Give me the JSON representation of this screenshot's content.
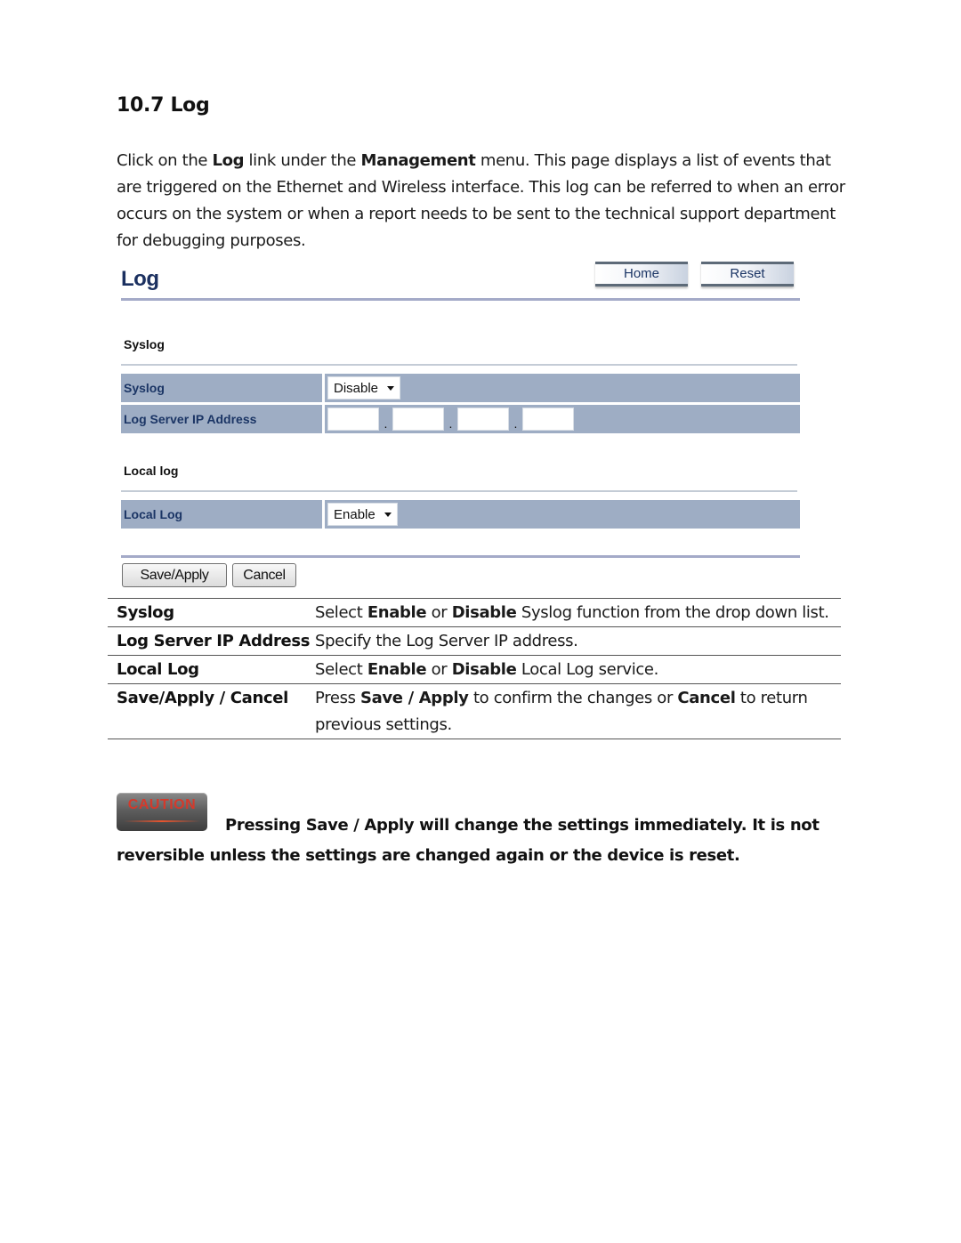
{
  "section_title": "10.7 Log",
  "intro": {
    "p1": "Click on the ",
    "b1": "Log",
    "p2": " link under the ",
    "b2": "Management",
    "p3": " menu. This page displays a list of events that are triggered on the Ethernet and Wireless interface. This log can be referred to when an error occurs on the system or when a report needs to be sent to the technical support department for debugging purposes."
  },
  "ui": {
    "title": "Log",
    "home_label": "Home",
    "reset_label": "Reset",
    "syslog_section": "Syslog",
    "syslog_row_label": "Syslog",
    "syslog_value": "Disable",
    "log_server_label": "Log Server IP Address",
    "ip_octets": [
      "",
      "",
      "",
      ""
    ],
    "ip_separator": ".",
    "local_section": "Local log",
    "local_row_label": "Local Log",
    "local_value": "Enable",
    "save_label": "Save/Apply",
    "cancel_label": "Cancel",
    "colors": {
      "row_bg": "#9eadc4",
      "label_text": "#1b3565",
      "rule": "#a4aac8"
    }
  },
  "table": {
    "rows": [
      {
        "term": "Syslog",
        "d1": "Select ",
        "d1b": "Enable",
        "d2": " or ",
        "d2b": "Disable",
        "d3": " Syslog function from the drop down list."
      },
      {
        "term": "Log Server IP Address",
        "d1": "Specify the Log Server IP address."
      },
      {
        "term": "Local Log",
        "d1": "Select ",
        "d1b": "Enable",
        "d2": " or ",
        "d2b": "Disable",
        "d3": " Local Log service."
      },
      {
        "term": "Save/Apply / Cancel",
        "d1": "Press ",
        "d1b": "Save / Apply",
        "d2": " to confirm the changes or ",
        "d2b": "Cancel",
        "d3": " to return previous settings."
      }
    ]
  },
  "caution": {
    "badge": "CAUTION",
    "text": "Pressing Save / Apply will change the settings immediately. It is not reversible unless the settings are changed again or the device is reset.",
    "badge_text_color": "#d33a2c"
  }
}
